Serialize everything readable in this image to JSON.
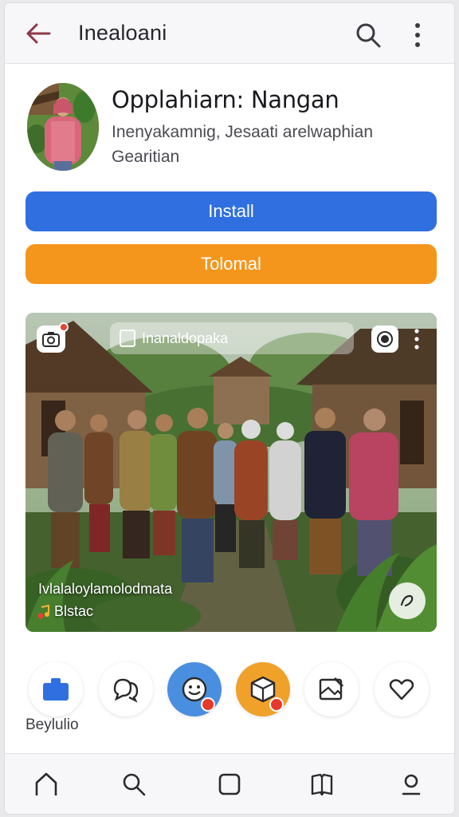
{
  "appbar": {
    "title": "Inealoani",
    "back_icon": "arrow-left-icon",
    "search_icon": "search-icon",
    "more_icon": "more-vertical-icon"
  },
  "app": {
    "name": "Opplahiarn: Nangan",
    "subtitle": "Inenyakamnig, Jesaati arelwaphian Gearitian"
  },
  "buttons": {
    "install_label": "Install",
    "secondary_label": "Tolomal"
  },
  "media": {
    "overlay_title": "Inanaldopaka",
    "caption": "Ivlalaloylamolodmata",
    "source": "Blstac"
  },
  "actions": {
    "label": "Beylulio",
    "items": [
      "briefcase-icon",
      "chat-icon",
      "smile-icon",
      "box-icon",
      "image-edit-icon",
      "heart-icon"
    ]
  },
  "bottom_nav": {
    "items": [
      "home-icon",
      "search-icon",
      "square-icon",
      "book-icon",
      "profile-icon"
    ]
  },
  "colors": {
    "install": "#2f6fe0",
    "secondary": "#f5961c",
    "badge": "#e6392c",
    "action_blue": "#4a8ee0",
    "action_orange": "#f0a12a"
  }
}
